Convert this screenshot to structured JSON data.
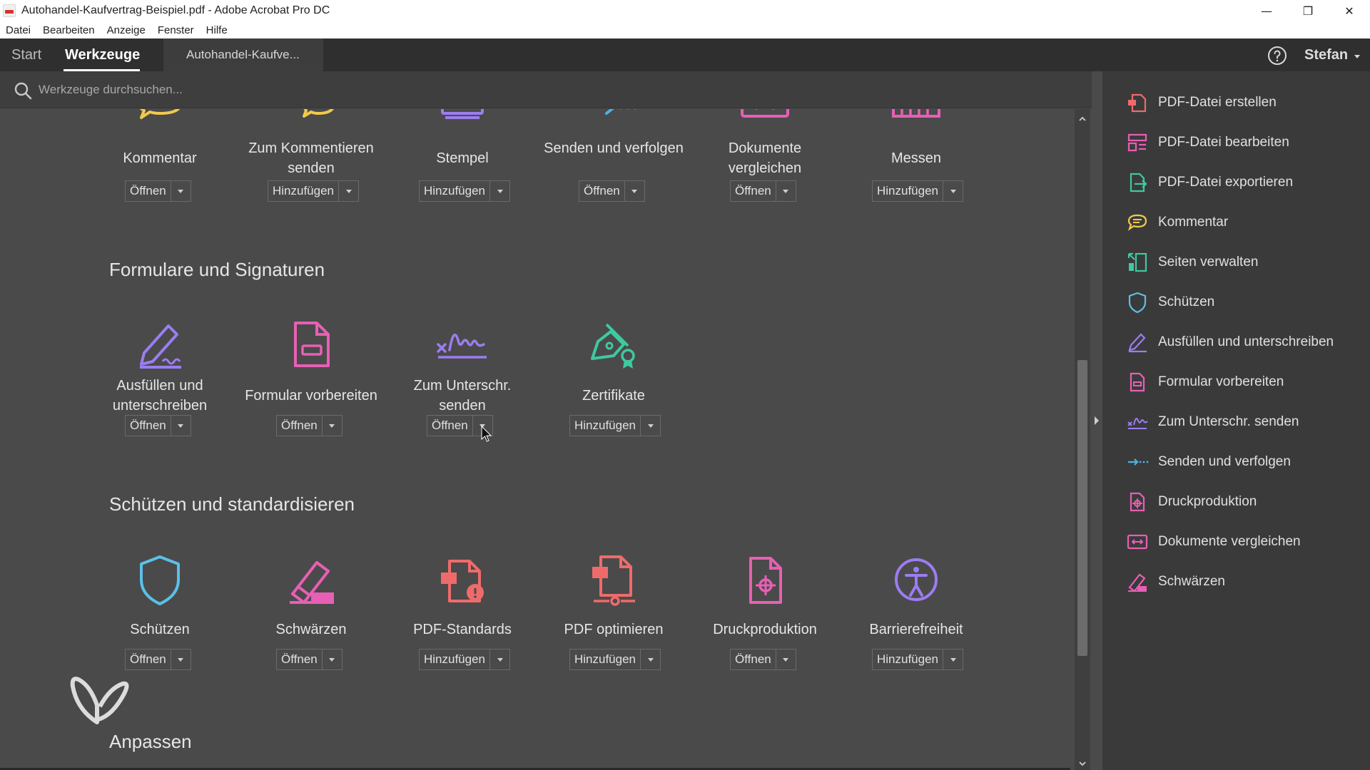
{
  "window": {
    "title": "Autohandel-Kaufvertrag-Beispiel.pdf - Adobe Acrobat Pro DC",
    "controls": {
      "minimize": "—",
      "restore": "❐",
      "close": "✕"
    }
  },
  "menubar": {
    "items": [
      "Datei",
      "Bearbeiten",
      "Anzeige",
      "Fenster",
      "Hilfe"
    ]
  },
  "tabs": {
    "start": "Start",
    "tools": "Werkzeuge",
    "document": "Autohandel-Kaufve..."
  },
  "user": {
    "name": "Stefan"
  },
  "search": {
    "placeholder": "Werkzeuge durchsuchen..."
  },
  "sections": {
    "review": {
      "tools": [
        {
          "label": "Kommentar",
          "button": "Öffnen",
          "color": "#f2c94c",
          "icon": "comment-icon"
        },
        {
          "label": "Zum Kommentieren senden",
          "button": "Hinzufügen",
          "color": "#f2c94c",
          "icon": "send-for-comments-icon"
        },
        {
          "label": "Stempel",
          "button": "Hinzufügen",
          "color": "#9b7df0",
          "icon": "stamp-icon"
        },
        {
          "label": "Senden und verfolgen",
          "button": "Öffnen",
          "color": "#4ab4e6",
          "icon": "send-track-icon"
        },
        {
          "label": "Dokumente vergleichen",
          "button": "Öffnen",
          "color": "#e85fb5",
          "icon": "compare-icon"
        },
        {
          "label": "Messen",
          "button": "Hinzufügen",
          "color": "#e85fb5",
          "icon": "measure-icon"
        }
      ]
    },
    "forms": {
      "heading": "Formulare und Signaturen",
      "tools": [
        {
          "label": "Ausfüllen und unterschreiben",
          "button": "Öffnen",
          "color": "#9b7df0",
          "icon": "fill-sign-icon"
        },
        {
          "label": "Formular vorbereiten",
          "button": "Öffnen",
          "color": "#e85fb5",
          "icon": "prepare-form-icon"
        },
        {
          "label": "Zum Unterschr. senden",
          "button": "Öffnen",
          "color": "#9b7df0",
          "icon": "send-for-signature-icon"
        },
        {
          "label": "Zertifikate",
          "button": "Hinzufügen",
          "color": "#3ec9a0",
          "icon": "certificates-icon"
        }
      ]
    },
    "protect": {
      "heading": "Schützen und standardisieren",
      "tools": [
        {
          "label": "Schützen",
          "button": "Öffnen",
          "color": "#5bc0e8",
          "icon": "shield-icon"
        },
        {
          "label": "Schwärzen",
          "button": "Öffnen",
          "color": "#e85fb5",
          "icon": "redact-icon"
        },
        {
          "label": "PDF-Standards",
          "button": "Hinzufügen",
          "color": "#ef6b6b",
          "icon": "pdf-standards-icon"
        },
        {
          "label": "PDF optimieren",
          "button": "Hinzufügen",
          "color": "#ef6b6b",
          "icon": "optimize-pdf-icon"
        },
        {
          "label": "Druckproduktion",
          "button": "Öffnen",
          "color": "#e85fb5",
          "icon": "print-production-icon"
        },
        {
          "label": "Barrierefreiheit",
          "button": "Hinzufügen",
          "color": "#9b7df0",
          "icon": "accessibility-icon"
        }
      ]
    },
    "customize": {
      "heading": "Anpassen"
    }
  },
  "rightpane": {
    "items": [
      {
        "label": "PDF-Datei erstellen",
        "color": "#ef6b6b",
        "icon": "create-pdf-icon"
      },
      {
        "label": "PDF-Datei bearbeiten",
        "color": "#e85fb5",
        "icon": "edit-pdf-icon"
      },
      {
        "label": "PDF-Datei exportieren",
        "color": "#3ec9a0",
        "icon": "export-pdf-icon"
      },
      {
        "label": "Kommentar",
        "color": "#f2c94c",
        "icon": "comment-icon"
      },
      {
        "label": "Seiten verwalten",
        "color": "#3ec9a0",
        "icon": "organize-pages-icon"
      },
      {
        "label": "Schützen",
        "color": "#5bc0e8",
        "icon": "shield-icon"
      },
      {
        "label": "Ausfüllen und unterschreiben",
        "color": "#9b7df0",
        "icon": "fill-sign-icon"
      },
      {
        "label": "Formular vorbereiten",
        "color": "#e85fb5",
        "icon": "prepare-form-icon"
      },
      {
        "label": "Zum Unterschr. senden",
        "color": "#9b7df0",
        "icon": "send-for-signature-icon"
      },
      {
        "label": "Senden und verfolgen",
        "color": "#4ab4e6",
        "icon": "send-track-icon"
      },
      {
        "label": "Druckproduktion",
        "color": "#e85fb5",
        "icon": "print-production-icon"
      },
      {
        "label": "Dokumente vergleichen",
        "color": "#e85fb5",
        "icon": "compare-icon"
      },
      {
        "label": "Schwärzen",
        "color": "#e85fb5",
        "icon": "redact-icon"
      }
    ]
  }
}
